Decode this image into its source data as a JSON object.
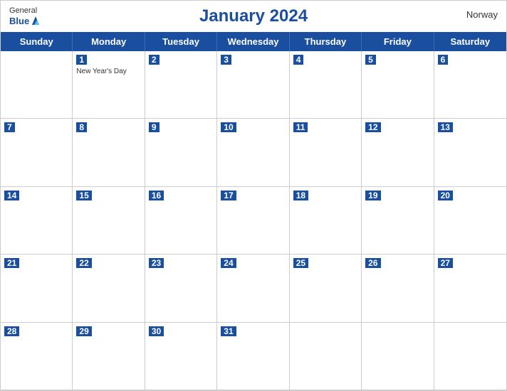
{
  "header": {
    "title": "January 2024",
    "country": "Norway",
    "logo_general": "General",
    "logo_blue": "Blue"
  },
  "days_of_week": [
    "Sunday",
    "Monday",
    "Tuesday",
    "Wednesday",
    "Thursday",
    "Friday",
    "Saturday"
  ],
  "weeks": [
    [
      {
        "day": "",
        "event": ""
      },
      {
        "day": "1",
        "event": "New Year's Day"
      },
      {
        "day": "2",
        "event": ""
      },
      {
        "day": "3",
        "event": ""
      },
      {
        "day": "4",
        "event": ""
      },
      {
        "day": "5",
        "event": ""
      },
      {
        "day": "6",
        "event": ""
      }
    ],
    [
      {
        "day": "7",
        "event": ""
      },
      {
        "day": "8",
        "event": ""
      },
      {
        "day": "9",
        "event": ""
      },
      {
        "day": "10",
        "event": ""
      },
      {
        "day": "11",
        "event": ""
      },
      {
        "day": "12",
        "event": ""
      },
      {
        "day": "13",
        "event": ""
      }
    ],
    [
      {
        "day": "14",
        "event": ""
      },
      {
        "day": "15",
        "event": ""
      },
      {
        "day": "16",
        "event": ""
      },
      {
        "day": "17",
        "event": ""
      },
      {
        "day": "18",
        "event": ""
      },
      {
        "day": "19",
        "event": ""
      },
      {
        "day": "20",
        "event": ""
      }
    ],
    [
      {
        "day": "21",
        "event": ""
      },
      {
        "day": "22",
        "event": ""
      },
      {
        "day": "23",
        "event": ""
      },
      {
        "day": "24",
        "event": ""
      },
      {
        "day": "25",
        "event": ""
      },
      {
        "day": "26",
        "event": ""
      },
      {
        "day": "27",
        "event": ""
      }
    ],
    [
      {
        "day": "28",
        "event": ""
      },
      {
        "day": "29",
        "event": ""
      },
      {
        "day": "30",
        "event": ""
      },
      {
        "day": "31",
        "event": ""
      },
      {
        "day": "",
        "event": ""
      },
      {
        "day": "",
        "event": ""
      },
      {
        "day": "",
        "event": ""
      }
    ]
  ]
}
